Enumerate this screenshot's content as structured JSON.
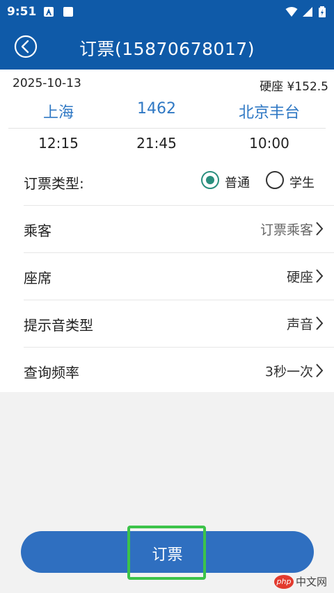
{
  "status_bar": {
    "time": "9:51"
  },
  "app_bar": {
    "title": "订票(15870678017)"
  },
  "train": {
    "date": "2025-10-13",
    "seat_price": "硬座 ¥152.5",
    "from_station": "上海",
    "train_no": "1462",
    "to_station": "北京丰台",
    "depart_time": "12:15",
    "arrive_time": "21:45",
    "duration": "10:00"
  },
  "form": {
    "ticket_type_label": "订票类型:",
    "ticket_type_options": [
      "普通",
      "学生"
    ],
    "ticket_type_selected": "普通",
    "passenger_label": "乘客",
    "passenger_value": "订票乘客",
    "seat_label": "座席",
    "seat_value": "硬座",
    "alert_label": "提示音类型",
    "alert_value": "声音",
    "frequency_label": "查询频率",
    "frequency_value": "3秒一次"
  },
  "book_button": {
    "label": "订票"
  },
  "watermark": {
    "badge": "php",
    "text": "中文网"
  },
  "colors": {
    "primary": "#0f5aa8",
    "button": "#2f6fc0",
    "radio": "#2a8f7e",
    "highlight": "#3cc34a"
  }
}
